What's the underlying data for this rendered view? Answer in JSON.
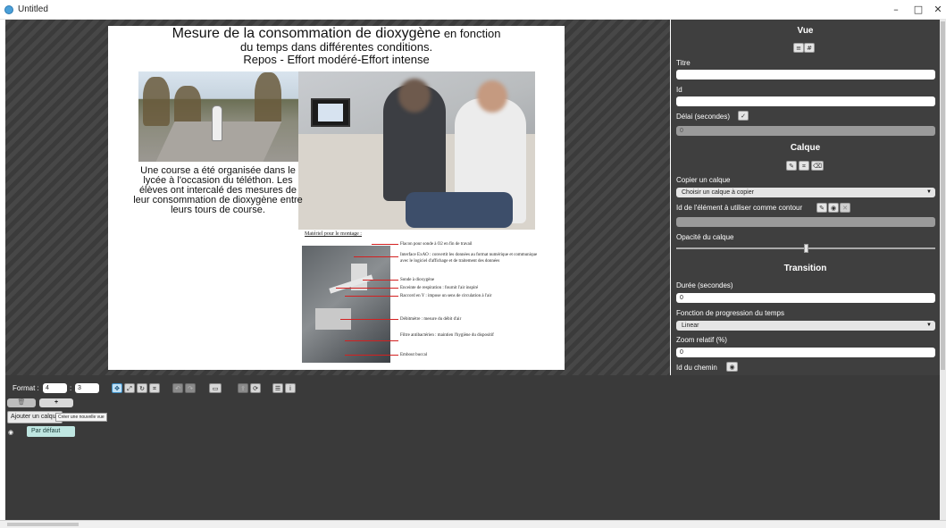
{
  "window": {
    "title": "Untitled",
    "minimize": "–",
    "maximize": "□",
    "close": "✕"
  },
  "slide": {
    "title_line1_main": "Mesure de la consommation de dioxygène",
    "title_line1_tail": " en fonction",
    "title_line2": "du temps  dans différentes conditions.",
    "title_line3": "Repos - Effort modéré-Effort intense",
    "body_text": "Une course a été organisée dans le lycée à l'occasion du téléthon. Les élèves ont intercalé des mesures de leur consommation de dioxygène entre leurs tours de course.",
    "materiel_label": "Matériel pour le montage :",
    "callouts": [
      "Flacon pour sonde à O2 en fin de travail",
      "Interface ExAO : convertit les données au format numérique et communique avec le logiciel d'affichage et de traitement des données",
      "Sonde à dioxygène",
      "Enceinte de respiration : fournit  l'air inspiré",
      "Raccord en Y : impose un sens de circulation à l'air",
      "Débitmètre : mesure du débit d'air",
      "Filtre antibactérien : maintien l'hygiène du dispositif",
      "Embout buccal"
    ]
  },
  "panel": {
    "vue_title": "Vue",
    "titre_label": "Titre",
    "titre_value": "",
    "id_label": "Id",
    "id_value": "",
    "delai_label": "Délai (secondes)",
    "delai_value": "0",
    "calque_title": "Calque",
    "copier_label": "Copier un calque",
    "copier_select": "Choisir un calque à copier",
    "contour_label": "Id de l'élément à utiliser comme contour",
    "contour_value": "",
    "opacite_label": "Opacité du calque",
    "opacite_value": 0.5,
    "transition_title": "Transition",
    "duree_label": "Durée (secondes)",
    "duree_value": "0",
    "fonction_label": "Fonction de progression du temps",
    "fonction_select": "Linear",
    "zoom_label": "Zoom relatif (%)",
    "zoom_value": "0",
    "chemin_label": "Id du chemin"
  },
  "bottom": {
    "format_label": "Format :",
    "format_w": "4",
    "format_sep": ":",
    "format_h": "3",
    "add_layer_label": "Ajouter un calque",
    "tooltip": "Créer une nouvelle vue",
    "plus_label": "+",
    "layer_name": "Par défaut"
  },
  "colors": {
    "panel_bg": "#3f3f3f",
    "accent_blue": "#3e8ec4",
    "layer_pill": "#bfe6e1"
  }
}
